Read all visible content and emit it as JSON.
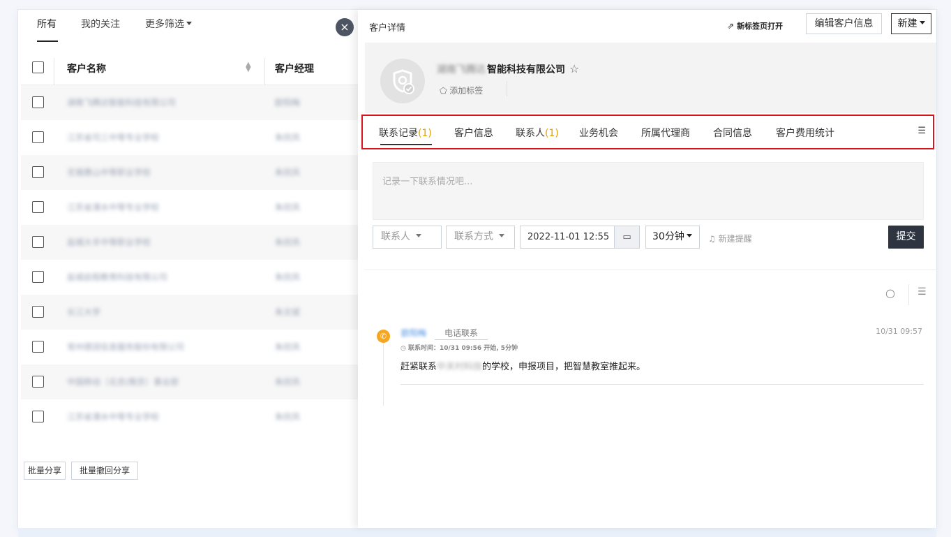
{
  "filters": {
    "all": "所有",
    "following": "我的关注",
    "more": "更多筛选"
  },
  "table": {
    "col_name": "客户名称",
    "col_manager": "客户经理",
    "rows": [
      {
        "name": "湖南飞腾达智能科技有限公司",
        "manager": "欧阳梅"
      },
      {
        "name": "江苏省司三中等专业学校",
        "manager": "朱欣凤"
      },
      {
        "name": "无锡惠山中等职业学校",
        "manager": "朱欣凤"
      },
      {
        "name": "江苏省溧水中等专业学校",
        "manager": "朱欣凤"
      },
      {
        "name": "盐城大丰中等职业学校",
        "manager": "朱欣凤"
      },
      {
        "name": "盐城启程教育科技有限公司",
        "manager": "朱欣凤"
      },
      {
        "name": "长江大学",
        "manager": "朱文斌"
      },
      {
        "name": "常州德润信息服务股份有限公司",
        "manager": "朱欣凤"
      },
      {
        "name": "中国移动（北京/南京）事业部",
        "manager": "朱欣凤"
      },
      {
        "name": "江苏省溧水中等专业学校",
        "manager": "朱欣凤"
      }
    ]
  },
  "batch": {
    "share": "批量分享",
    "revoke": "批量撤回分享"
  },
  "close_glyph": "×",
  "detail": {
    "title": "客户详情",
    "open_new_tab": "新标签页打开",
    "edit_button": "编辑客户信息",
    "new_button": "新建",
    "company_name_blurred": "湖南飞腾达",
    "company_name_visible": "智能科技有限公司",
    "star_glyph": "☆",
    "add_tag": "添加标签",
    "tabs": [
      {
        "label": "联系记录",
        "count": "(1)"
      },
      {
        "label": "客户信息",
        "count": ""
      },
      {
        "label": "联系人",
        "count": "(1)"
      },
      {
        "label": "业务机会",
        "count": ""
      },
      {
        "label": "所属代理商",
        "count": ""
      },
      {
        "label": "合同信息",
        "count": ""
      },
      {
        "label": "客户费用统计",
        "count": ""
      }
    ],
    "note_placeholder": "记录一下联系情况吧...",
    "contact_select": "联系人",
    "method_select": "联系方式",
    "date_value": "2022-11-01 12:55",
    "duration": "30分钟",
    "new_reminder": "新建提醒",
    "submit": "提交"
  },
  "record": {
    "user": "欧阳梅",
    "type": "电话联系",
    "time_info": "联系时间：10/31 09:56 开始, 5分钟",
    "content_before": "赶紧联系",
    "content_blurred": "中关村科技",
    "content_after": "的学校，申报项目，把智慧教室推起来。",
    "stamp": "10/31 09:57"
  }
}
